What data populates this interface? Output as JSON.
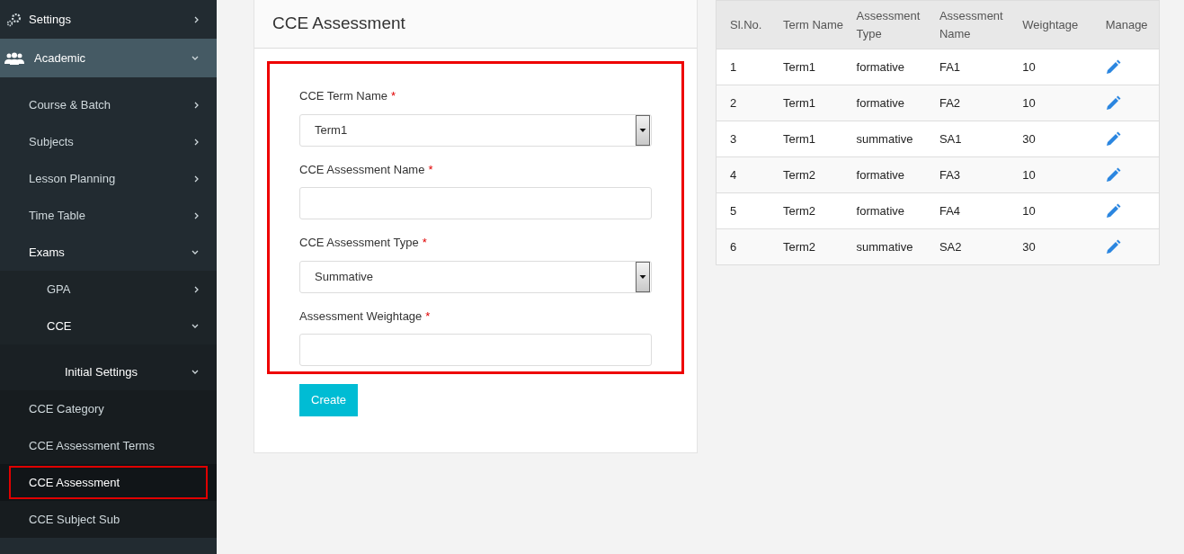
{
  "sidebar": {
    "items": [
      {
        "label": "Settings",
        "expanded": false,
        "selected": false
      },
      {
        "label": "Academic",
        "expanded": true,
        "selected": false,
        "children": [
          {
            "label": "Course & Batch",
            "expanded": false,
            "selected": false
          },
          {
            "label": "Subjects",
            "expanded": false,
            "selected": false
          },
          {
            "label": "Lesson Planning",
            "expanded": false,
            "selected": false
          },
          {
            "label": "Time Table",
            "expanded": false,
            "selected": false
          },
          {
            "label": "Exams",
            "expanded": true,
            "selected": false,
            "children": [
              {
                "label": "GPA",
                "expanded": false,
                "selected": false
              },
              {
                "label": "CCE",
                "expanded": true,
                "selected": false,
                "children": [
                  {
                    "label": "Initial Settings",
                    "expanded": true,
                    "selected": false,
                    "children": [
                      {
                        "label": "CCE Category",
                        "selected": false
                      },
                      {
                        "label": "CCE Assessment Terms",
                        "selected": false
                      },
                      {
                        "label": "CCE Assessment",
                        "selected": true
                      },
                      {
                        "label": "CCE Subject Sub",
                        "selected": false
                      }
                    ]
                  }
                ]
              }
            ]
          }
        ]
      }
    ]
  },
  "form": {
    "title": "CCE Assessment",
    "fields": [
      {
        "kind": "select",
        "label": "CCE Term Name",
        "required_mark": "*",
        "value": "Term1"
      },
      {
        "kind": "text",
        "label": "CCE Assessment Name",
        "required_mark": "*"
      },
      {
        "kind": "select",
        "label": "CCE Assessment Type",
        "required_mark": "*",
        "value": "Summative"
      },
      {
        "kind": "text",
        "label": "Assessment Weightage",
        "required_mark": "*"
      }
    ],
    "submit": "Create"
  },
  "table": {
    "columns": [
      "Sl.No.",
      "Term Name",
      "Assessment Type",
      "Assessment Name",
      "Weightage",
      "Manage"
    ],
    "rows": [
      [
        "1",
        "Term1",
        "formative",
        "FA1",
        "10"
      ],
      [
        "2",
        "Term1",
        "formative",
        "FA2",
        "10"
      ],
      [
        "3",
        "Term1",
        "summative",
        "SA1",
        "30"
      ],
      [
        "4",
        "Term2",
        "formative",
        "FA3",
        "10"
      ],
      [
        "5",
        "Term2",
        "formative",
        "FA4",
        "10"
      ],
      [
        "6",
        "Term2",
        "summative",
        "SA2",
        "30"
      ]
    ]
  }
}
